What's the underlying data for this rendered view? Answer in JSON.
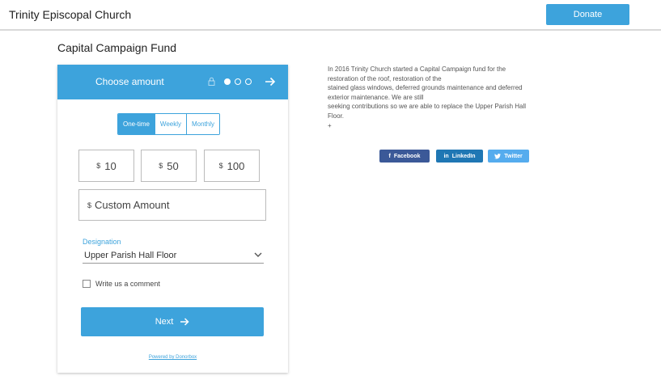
{
  "header": {
    "site_title": "Trinity Episcopal Church",
    "donate_label": "Donate"
  },
  "page": {
    "title": "Capital Campaign Fund"
  },
  "widget": {
    "step_title": "Choose amount",
    "frequency": [
      {
        "label": "One-time",
        "active": true
      },
      {
        "label": "Weekly",
        "active": false
      },
      {
        "label": "Monthly",
        "active": false
      }
    ],
    "currency_symbol": "$",
    "amounts": [
      "10",
      "50",
      "100"
    ],
    "custom_amount_placeholder": "Custom Amount",
    "designation_label": "Designation",
    "designation_value": "Upper Parish Hall Floor",
    "comment_label": "Write us a comment",
    "next_label": "Next",
    "powered_by": "Powered by Donorbox"
  },
  "description": {
    "lines": [
      "In 2016 Trinity Church started a Capital Campaign fund for the",
      "restoration of the roof, restoration of the",
      "stained glass windows, deferred grounds maintenance and deferred",
      "exterior maintenance.  We are still",
      "seeking contributions so we are able to replace the Upper Parish Hall",
      "Floor.",
      "+"
    ]
  },
  "share": {
    "facebook": {
      "label": "Facebook",
      "icon": "f",
      "color": "#3b5998"
    },
    "linkedin": {
      "label": "LinkedIn",
      "icon": "in",
      "color": "#1f77b4"
    },
    "twitter": {
      "label": "Twitter",
      "icon": "twitter-icon",
      "color": "#55acee"
    }
  },
  "colors": {
    "accent": "#3da3dc"
  }
}
